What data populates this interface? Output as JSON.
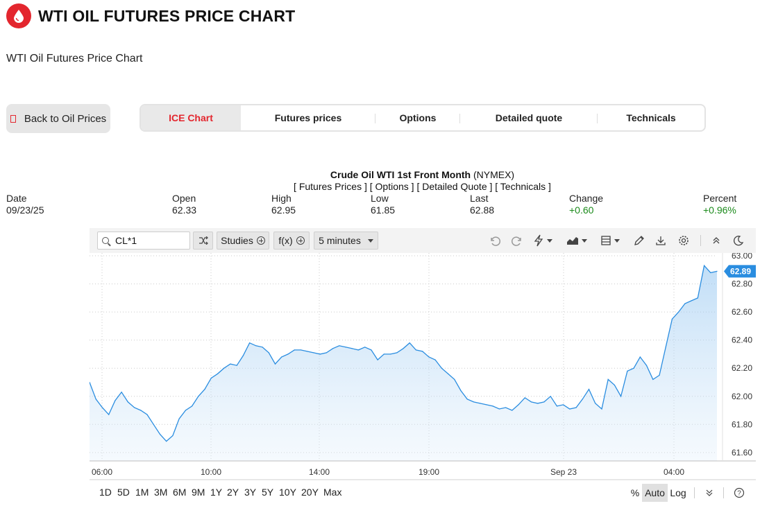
{
  "header": {
    "title": "WTI OIL FUTURES PRICE CHART",
    "subtitle": "WTI Oil Futures Price Chart",
    "logo_icon": "oil-drop-icon",
    "brand_color": "#e3262e"
  },
  "back_button": {
    "label": "Back to Oil Prices"
  },
  "tabs": [
    {
      "label": "ICE Chart",
      "active": true
    },
    {
      "label": "Futures prices",
      "active": false
    },
    {
      "label": "Options",
      "active": false
    },
    {
      "label": "Detailed quote",
      "active": false
    },
    {
      "label": "Technicals",
      "active": false
    }
  ],
  "quote": {
    "title_bold": "Crude Oil WTI 1st Front Month",
    "title_exchange": "(NYMEX)",
    "links": "[ Futures Prices ] [ Options ] [ Detailed Quote ] [ Technicals ]",
    "stats": [
      {
        "label": "Date",
        "value": "09/23/25"
      },
      {
        "label": "Open",
        "value": "62.33"
      },
      {
        "label": "High",
        "value": "62.95"
      },
      {
        "label": "Low",
        "value": "61.85"
      },
      {
        "label": "Last",
        "value": "62.88"
      },
      {
        "label": "Change",
        "value": "+0.60"
      },
      {
        "label": "Percent",
        "value": "+0.96%"
      }
    ]
  },
  "toolbar": {
    "symbol": "CL*1",
    "studies_label": "Studies",
    "fx_label": "f(x)",
    "interval_label": "5 minutes",
    "icons": [
      "shuffle-icon",
      "undo-icon",
      "redo-icon",
      "lightning-icon",
      "chart-type-icon",
      "layout-icon",
      "pencil-icon",
      "download-icon",
      "gear-icon",
      "collapse-icon",
      "dark-mode-icon"
    ]
  },
  "chart_data": {
    "type": "area",
    "y_ticks": [
      "63.00",
      "62.80",
      "62.60",
      "62.40",
      "62.20",
      "62.00",
      "61.80",
      "61.60"
    ],
    "ylim": [
      61.54,
      63.02
    ],
    "x_ticks": [
      "06:00",
      "10:00",
      "14:00",
      "19:00",
      "Sep 23",
      "04:00"
    ],
    "last_label": "62.89",
    "grid": true,
    "line_color": "#2a8de0",
    "series": [
      {
        "x": [
          "05:30",
          "05:45",
          "06:00",
          "06:15",
          "06:30",
          "06:45",
          "07:00",
          "07:15",
          "07:30",
          "07:45",
          "08:00",
          "08:15",
          "08:30",
          "08:45",
          "09:00",
          "09:15",
          "09:30",
          "09:45",
          "10:00",
          "10:15",
          "10:30",
          "10:45",
          "11:00",
          "11:15",
          "11:30",
          "11:45",
          "12:00",
          "12:15",
          "12:30",
          "12:45",
          "13:00",
          "13:15",
          "13:30",
          "13:45",
          "14:00",
          "14:15",
          "14:30",
          "14:45",
          "15:00",
          "15:15",
          "15:30",
          "15:45",
          "16:00",
          "16:15",
          "16:30",
          "16:45",
          "17:00",
          "17:15",
          "17:30",
          "17:45",
          "18:00",
          "18:15",
          "18:30",
          "18:45",
          "19:00",
          "19:15",
          "19:30",
          "19:45",
          "20:00",
          "20:15",
          "20:30",
          "20:45",
          "21:00",
          "21:15",
          "21:30",
          "21:45",
          "22:00",
          "22:15",
          "22:30",
          "22:45",
          "23:00",
          "23:15",
          "23:30",
          "23:45",
          "00:00",
          "00:15",
          "00:30",
          "00:45",
          "01:00",
          "01:15",
          "01:30",
          "01:45",
          "02:00",
          "02:15",
          "02:30",
          "02:45",
          "03:00",
          "03:15",
          "03:30",
          "03:45",
          "04:00",
          "04:15",
          "04:30",
          "04:45",
          "05:00",
          "05:15",
          "05:30",
          "05:45",
          "06:00"
        ],
        "values": [
          62.1,
          61.98,
          61.92,
          61.87,
          61.97,
          62.03,
          61.96,
          61.92,
          61.9,
          61.87,
          61.8,
          61.73,
          61.68,
          61.72,
          61.84,
          61.9,
          61.93,
          62.0,
          62.05,
          62.13,
          62.16,
          62.2,
          62.23,
          62.22,
          62.29,
          62.38,
          62.36,
          62.35,
          62.31,
          62.23,
          62.28,
          62.3,
          62.33,
          62.33,
          62.32,
          62.31,
          62.3,
          62.31,
          62.34,
          62.36,
          62.35,
          62.34,
          62.33,
          62.35,
          62.33,
          62.26,
          62.3,
          62.3,
          62.31,
          62.34,
          62.38,
          62.33,
          62.32,
          62.28,
          62.26,
          62.2,
          62.16,
          62.12,
          62.04,
          61.98,
          61.96,
          61.95,
          61.94,
          61.93,
          61.91,
          61.92,
          61.9,
          61.94,
          61.99,
          61.96,
          61.95,
          61.96,
          62.0,
          61.93,
          61.94,
          61.91,
          61.92,
          61.98,
          62.05,
          61.95,
          61.91,
          62.12,
          62.08,
          62.0,
          62.18,
          62.2,
          62.28,
          62.22,
          62.12,
          62.15,
          62.35,
          62.55,
          62.6,
          62.66,
          62.68,
          62.7,
          62.93,
          62.88,
          62.89
        ]
      }
    ]
  },
  "ranges": [
    "1D",
    "5D",
    "1M",
    "3M",
    "6M",
    "9M",
    "1Y",
    "2Y",
    "3Y",
    "5Y",
    "10Y",
    "20Y",
    "Max"
  ],
  "scale_modes": [
    {
      "label": "%",
      "active": false
    },
    {
      "label": "Auto",
      "active": true
    },
    {
      "label": "Log",
      "active": false
    }
  ]
}
